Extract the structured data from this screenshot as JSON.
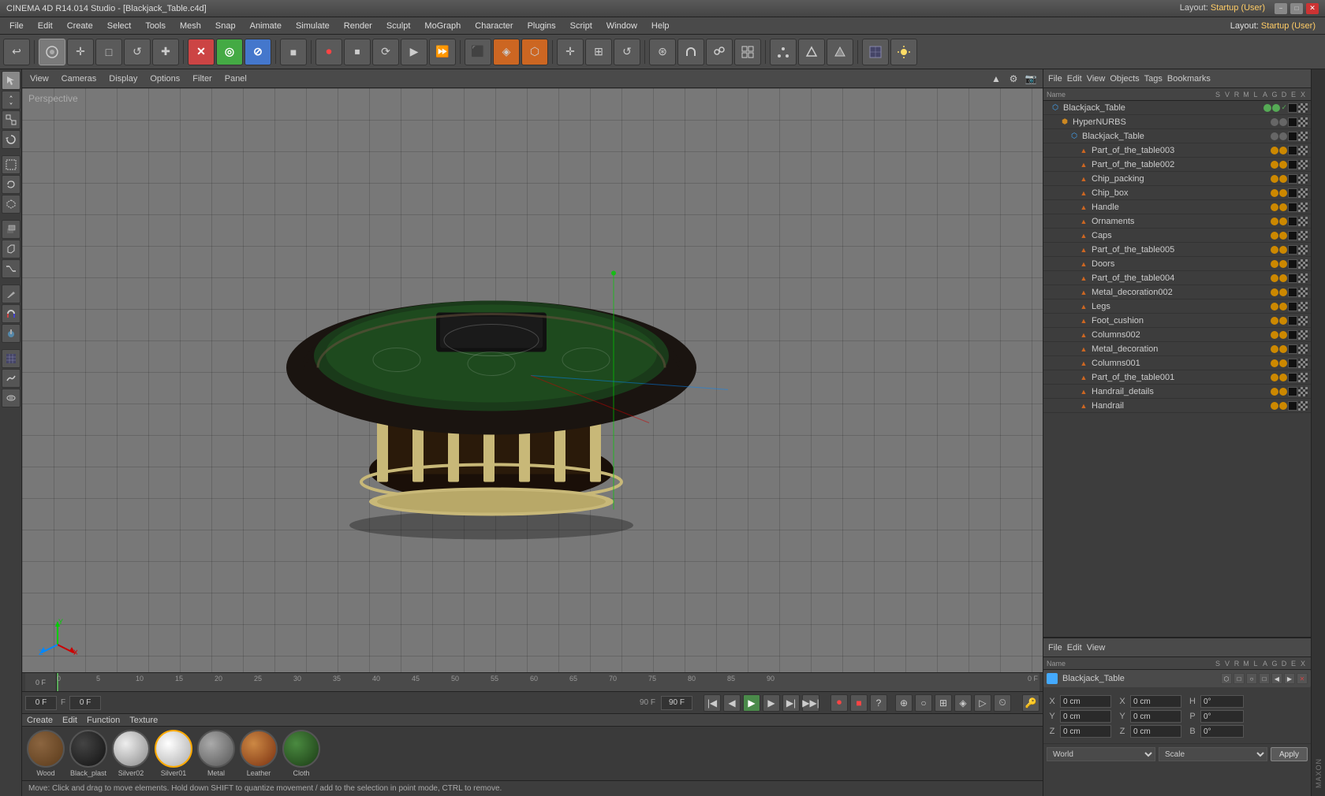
{
  "titlebar": {
    "title": "CINEMA 4D R14.014 Studio - [Blackjack_Table.c4d]",
    "layout_label": "Layout:",
    "layout_value": "Startup (User)"
  },
  "menubar": {
    "items": [
      "File",
      "Edit",
      "Create",
      "Select",
      "Tools",
      "Mesh",
      "Snap",
      "Animate",
      "Simulate",
      "Render",
      "Sculpt",
      "MoGraph",
      "Character",
      "Plugins",
      "Script",
      "Window",
      "Help"
    ]
  },
  "viewport": {
    "label": "Perspective",
    "menus": [
      "View",
      "Cameras",
      "Display",
      "Options",
      "Filter",
      "Panel"
    ]
  },
  "object_manager": {
    "menus": [
      "File",
      "Edit",
      "View",
      "Objects",
      "Tags",
      "Bookmarks"
    ],
    "objects": [
      {
        "name": "Blackjack_Table",
        "indent": 0,
        "type": "hypernurbs",
        "selected": false,
        "color": "green"
      },
      {
        "name": "HyperNURBS",
        "indent": 1,
        "type": "group",
        "selected": false,
        "color": "grey"
      },
      {
        "name": "Blackjack_Table",
        "indent": 2,
        "type": "object",
        "selected": false,
        "color": "grey"
      },
      {
        "name": "Part_of_the_table003",
        "indent": 3,
        "type": "mesh",
        "selected": false,
        "color": "grey"
      },
      {
        "name": "Part_of_the_table002",
        "indent": 3,
        "type": "mesh",
        "selected": false,
        "color": "grey"
      },
      {
        "name": "Chip_packing",
        "indent": 3,
        "type": "mesh",
        "selected": false,
        "color": "grey"
      },
      {
        "name": "Chip_box",
        "indent": 3,
        "type": "mesh",
        "selected": false,
        "color": "grey"
      },
      {
        "name": "Handle",
        "indent": 3,
        "type": "mesh",
        "selected": false,
        "color": "grey"
      },
      {
        "name": "Ornaments",
        "indent": 3,
        "type": "mesh",
        "selected": false,
        "color": "grey"
      },
      {
        "name": "Caps",
        "indent": 3,
        "type": "mesh",
        "selected": false,
        "color": "grey"
      },
      {
        "name": "Part_of_the_table005",
        "indent": 3,
        "type": "mesh",
        "selected": false,
        "color": "grey"
      },
      {
        "name": "Doors",
        "indent": 3,
        "type": "mesh",
        "selected": false,
        "color": "grey"
      },
      {
        "name": "Part_of_the_table004",
        "indent": 3,
        "type": "mesh",
        "selected": false,
        "color": "grey"
      },
      {
        "name": "Metal_decoration002",
        "indent": 3,
        "type": "mesh",
        "selected": false,
        "color": "grey"
      },
      {
        "name": "Legs",
        "indent": 3,
        "type": "mesh",
        "selected": false,
        "color": "grey"
      },
      {
        "name": "Foot_cushion",
        "indent": 3,
        "type": "mesh",
        "selected": false,
        "color": "grey"
      },
      {
        "name": "Columns002",
        "indent": 3,
        "type": "mesh",
        "selected": false,
        "color": "grey"
      },
      {
        "name": "Metal_decoration",
        "indent": 3,
        "type": "mesh",
        "selected": false,
        "color": "grey"
      },
      {
        "name": "Columns001",
        "indent": 3,
        "type": "mesh",
        "selected": false,
        "color": "grey"
      },
      {
        "name": "Part_of_the_table001",
        "indent": 3,
        "type": "mesh",
        "selected": false,
        "color": "grey"
      },
      {
        "name": "Handrail_details",
        "indent": 3,
        "type": "mesh",
        "selected": false,
        "color": "grey"
      },
      {
        "name": "Handrail",
        "indent": 3,
        "type": "mesh",
        "selected": false,
        "color": "grey"
      }
    ]
  },
  "attribute_manager": {
    "menus": [
      "File",
      "Edit",
      "View"
    ],
    "columns": [
      "Name",
      "S",
      "V",
      "R",
      "M",
      "L",
      "A",
      "G",
      "D",
      "E",
      "X"
    ],
    "selected_object": "Blackjack_Table"
  },
  "coordinates": {
    "x_pos": "0 cm",
    "y_pos": "0 cm",
    "z_pos": "0 cm",
    "x_size": "0 cm",
    "y_size": "0 cm",
    "z_size": "0 cm",
    "h": "0°",
    "p": "0°",
    "b": "0°",
    "coord_mode": "World",
    "transform_mode": "Scale",
    "apply_label": "Apply"
  },
  "materials": [
    {
      "name": "Wood",
      "type": "diffuse",
      "selected": false,
      "color": "#6b4c2a"
    },
    {
      "name": "Black_plast",
      "type": "diffuse",
      "selected": false,
      "color": "#222222"
    },
    {
      "name": "Silver02",
      "type": "metal",
      "selected": false,
      "color": "#aaaaaa"
    },
    {
      "name": "Silver01",
      "type": "metal",
      "selected": true,
      "color": "#cccccc"
    },
    {
      "name": "Metal",
      "type": "metal",
      "selected": false,
      "color": "#888888"
    },
    {
      "name": "Leather",
      "type": "leather",
      "selected": false,
      "color": "#8b4513"
    },
    {
      "name": "Cloth",
      "type": "cloth",
      "selected": false,
      "color": "#2d5a27"
    }
  ],
  "timeline": {
    "start": "0 F",
    "end": "90 F",
    "current": "0 F",
    "fps_indicator": "0 F",
    "ticks": [
      "0",
      "5",
      "10",
      "15",
      "20",
      "25",
      "30",
      "35",
      "40",
      "45",
      "50",
      "55",
      "60",
      "65",
      "70",
      "75",
      "80",
      "85",
      "90"
    ]
  },
  "statusbar": {
    "text": "Move: Click and drag to move elements. Hold down SHIFT to quantize movement / add to the selection in point mode, CTRL to remove."
  },
  "toolbar_icons": {
    "icons": [
      "↩",
      "⊙",
      "✛",
      "□",
      "↺",
      "✚",
      "✕",
      "◎",
      "⊘",
      "■",
      "≡",
      "→",
      "⏺",
      "⏹",
      "⟳",
      "▶",
      "⏩",
      "⬛",
      "◈",
      "⬡",
      "◐",
      "▣",
      "⊞",
      "☰",
      "⊛"
    ]
  }
}
